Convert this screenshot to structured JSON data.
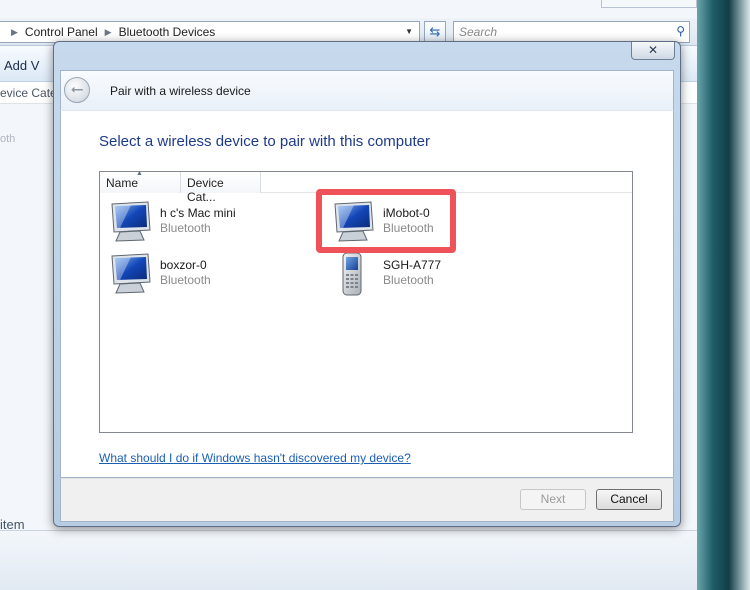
{
  "background_window": {
    "breadcrumb": [
      "Control Panel",
      "Bluetooth Devices"
    ],
    "search_placeholder": "Search",
    "toolbar_label": "Add V",
    "column_label": "evice Cate",
    "left_text": "oth",
    "status_text": "item"
  },
  "dialog": {
    "close_label": "✕",
    "title": "Pair with a wireless device",
    "instruction": "Select a wireless device to pair with this computer",
    "columns": [
      "Name",
      "Device Cat..."
    ],
    "devices": [
      {
        "name": "h c's Mac mini",
        "type": "Bluetooth",
        "icon": "computer-icon"
      },
      {
        "name": "iMobot-0",
        "type": "Bluetooth",
        "icon": "computer-icon",
        "highlighted": true
      },
      {
        "name": "boxzor-0",
        "type": "Bluetooth",
        "icon": "computer-icon"
      },
      {
        "name": "SGH-A777",
        "type": "Bluetooth",
        "icon": "phone-icon"
      }
    ],
    "help_link": "What should I do if Windows hasn't discovered my device?",
    "next_label": "Next",
    "cancel_label": "Cancel"
  },
  "colors": {
    "highlight": "#ef5258",
    "instruction_text": "#1e3b8a",
    "link": "#1b5fb5"
  }
}
